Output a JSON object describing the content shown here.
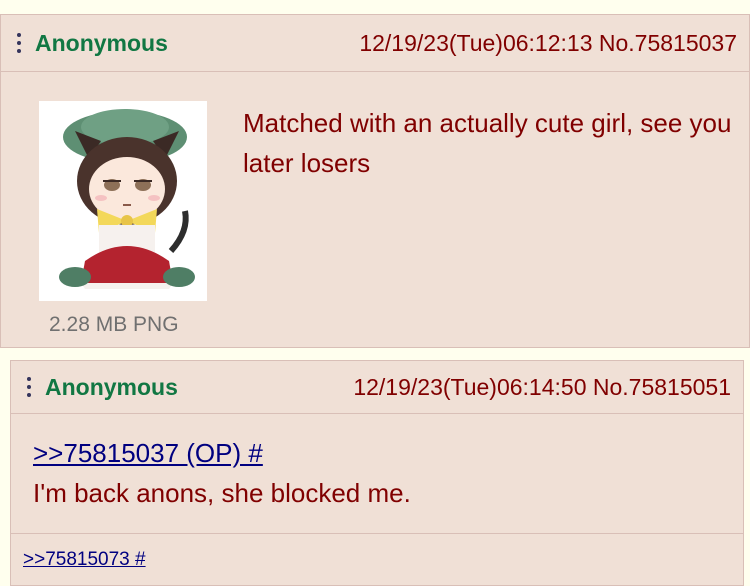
{
  "posts": [
    {
      "name": "Anonymous",
      "datetime": "12/19/23(Tue)06:12:13",
      "post_no": "No.75815037",
      "file_info": "2.28 MB PNG",
      "message": "Matched with an actually cute girl, see you later losers"
    },
    {
      "name": "Anonymous",
      "datetime": "12/19/23(Tue)06:14:50",
      "post_no": "No.75815051",
      "quote": ">>75815037 (OP) #",
      "message": "I'm back anons, she blocked me.",
      "backlinks": [
        ">>75815073 #"
      ]
    }
  ],
  "colors": {
    "page_bg": "#FFFFEE",
    "post_bg": "#F0E0D6",
    "post_border": "#D9BFB7",
    "name": "#117743",
    "text": "#800000",
    "link": "#000080",
    "file_info": "#707070"
  },
  "icons": {
    "menu": "vertical-dots-icon"
  }
}
